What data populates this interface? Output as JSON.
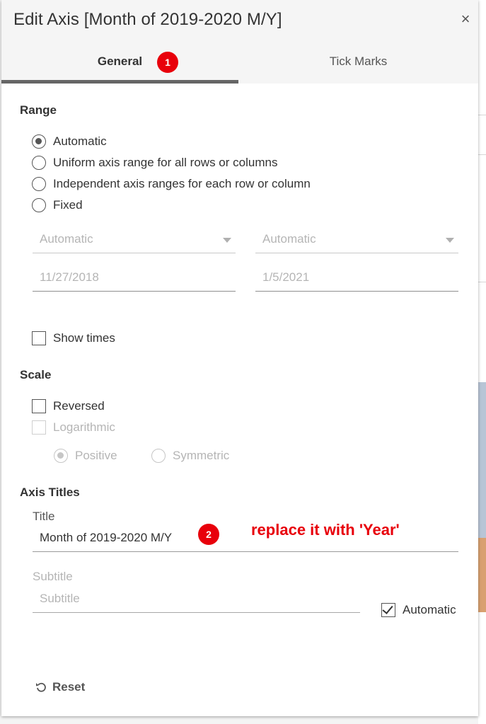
{
  "dialog": {
    "title": "Edit Axis [Month of 2019-2020 M/Y]",
    "close_glyph": "×"
  },
  "tabs": [
    {
      "label": "General",
      "active": true,
      "badge": "1"
    },
    {
      "label": "Tick Marks",
      "active": false
    }
  ],
  "range": {
    "heading": "Range",
    "options": [
      {
        "label": "Automatic",
        "selected": true
      },
      {
        "label": "Uniform axis range for all rows or columns",
        "selected": false
      },
      {
        "label": "Independent axis ranges for each row or column",
        "selected": false
      },
      {
        "label": "Fixed",
        "selected": false
      }
    ],
    "start_select": "Automatic",
    "end_select": "Automatic",
    "start_date": "11/27/2018",
    "end_date": "1/5/2021",
    "show_times_label": "Show times",
    "show_times_checked": false
  },
  "scale": {
    "heading": "Scale",
    "reversed_label": "Reversed",
    "reversed_checked": false,
    "logarithmic_label": "Logarithmic",
    "logarithmic_enabled": false,
    "positive_label": "Positive",
    "symmetric_label": "Symmetric"
  },
  "axis_titles": {
    "heading": "Axis Titles",
    "title_label": "Title",
    "title_value": "Month of 2019-2020 M/Y",
    "title_badge": "2",
    "annotation": "replace it with 'Year'",
    "subtitle_label": "Subtitle",
    "subtitle_placeholder": "Subtitle",
    "automatic_label": "Automatic",
    "automatic_checked": true
  },
  "footer": {
    "reset_label": "Reset"
  },
  "colors": {
    "badge": "#e8000b",
    "annotation": "#e8000b",
    "tab_underline": "#666666"
  }
}
